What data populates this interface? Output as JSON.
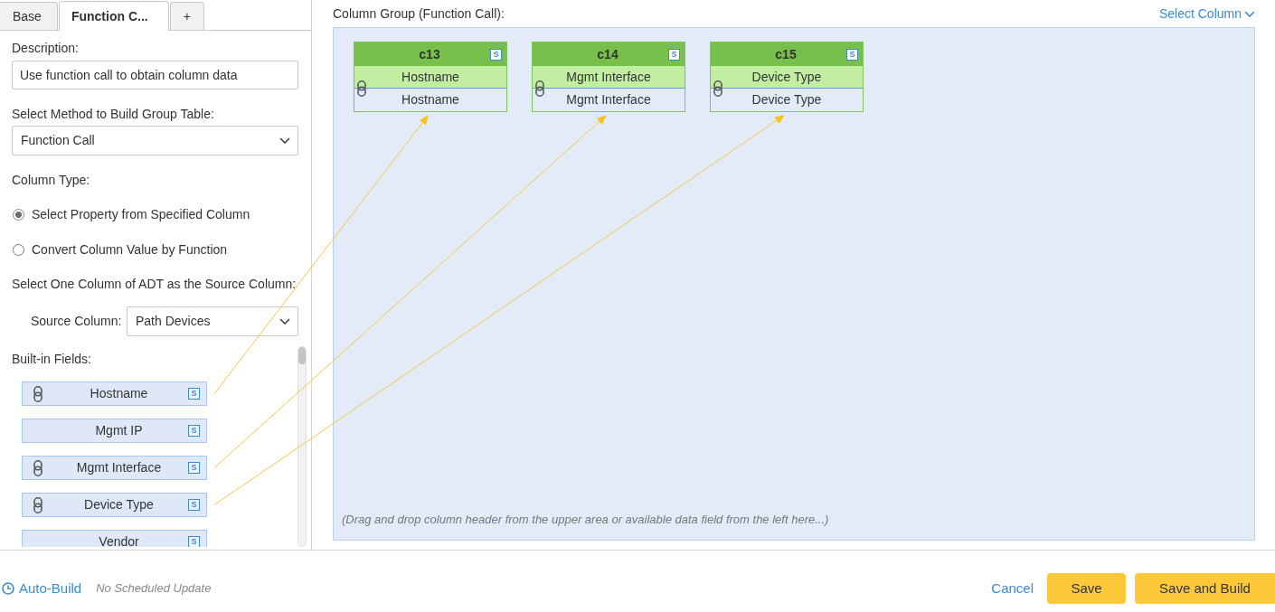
{
  "tabs": [
    {
      "label": "Base",
      "selected": false
    },
    {
      "label": "Function C...",
      "selected": true
    },
    {
      "label": "+",
      "selected": false
    }
  ],
  "form": {
    "description": {
      "label": "Description:",
      "value": "Use function call to obtain column data"
    },
    "method": {
      "label": "Select Method to Build Group Table:",
      "value": "Function Call"
    },
    "column_type": {
      "label": "Column Type:",
      "options": [
        {
          "label": "Select Property from Specified Column",
          "selected": true
        },
        {
          "label": "Convert Column Value by Function",
          "selected": false
        }
      ]
    },
    "source_prompt": "Select One Column of ADT as the Source Column:",
    "source_column": {
      "label": "Source Column:",
      "value": "Path Devices"
    }
  },
  "builtin_fields": {
    "label": "Built-in Fields:",
    "items": [
      {
        "label": "Hostname",
        "linked": true,
        "type": "S"
      },
      {
        "label": "Mgmt IP",
        "linked": false,
        "type": "S"
      },
      {
        "label": "Mgmt Interface",
        "linked": true,
        "type": "S"
      },
      {
        "label": "Device Type",
        "linked": true,
        "type": "S"
      },
      {
        "label": "Vendor",
        "linked": false,
        "type": "S"
      }
    ]
  },
  "column_group": {
    "title": "Column Group (Function Call):",
    "select_column": "Select Column",
    "columns": [
      {
        "name": "c13",
        "type": "S",
        "field": "Hostname",
        "source": "Hostname",
        "linked": true
      },
      {
        "name": "c14",
        "type": "S",
        "field": "Mgmt Interface",
        "source": "Mgmt Interface",
        "linked": true
      },
      {
        "name": "c15",
        "type": "S",
        "field": "Device Type",
        "source": "Device Type",
        "linked": true
      }
    ],
    "hint": "(Drag and drop column header from the upper area or available data field from the left here...)"
  },
  "footer": {
    "auto_build": "Auto-Build",
    "schedule": "No Scheduled Update",
    "cancel": "Cancel",
    "buttons": [
      "Save",
      "Save and Build"
    ]
  }
}
